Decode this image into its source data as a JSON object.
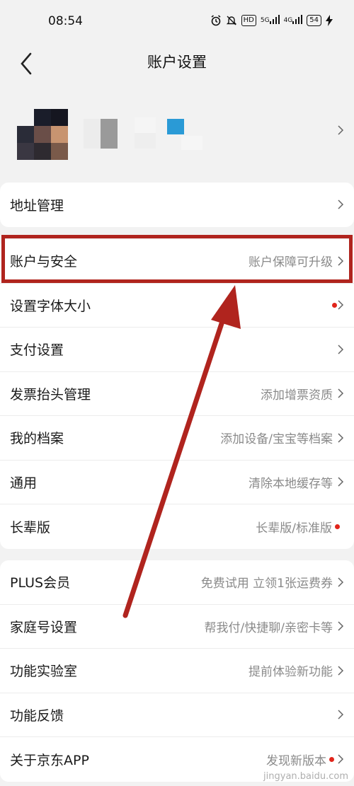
{
  "status_bar": {
    "time": "08:54",
    "indicators": [
      "alarm-icon",
      "mute-icon"
    ],
    "hd_label": "HD",
    "signal1": "5G",
    "signal2": "4G",
    "battery": "54"
  },
  "header": {
    "title": "账户设置"
  },
  "sections": [
    {
      "items": [
        {
          "label": "地址管理",
          "value": "",
          "dot": false
        }
      ]
    },
    {
      "items": [
        {
          "label": "账户与安全",
          "value": "账户保障可升级",
          "dot": false
        },
        {
          "label": "设置字体大小",
          "value": "",
          "dot": true
        },
        {
          "label": "支付设置",
          "value": "",
          "dot": false
        },
        {
          "label": "发票抬头管理",
          "value": "添加增票资质",
          "dot": false
        },
        {
          "label": "我的档案",
          "value": "添加设备/宝宝等档案",
          "dot": false
        },
        {
          "label": "通用",
          "value": "清除本地缓存等",
          "dot": false
        },
        {
          "label": "长辈版",
          "value": "长辈版/标准版",
          "dot": true
        }
      ]
    },
    {
      "items": [
        {
          "label": "PLUS会员",
          "value": "免费试用 立领1张运费券",
          "dot": false
        },
        {
          "label": "家庭号设置",
          "value": "帮我付/快捷聊/亲密卡等",
          "dot": false
        },
        {
          "label": "功能实验室",
          "value": "提前体验新功能",
          "dot": false
        },
        {
          "label": "功能反馈",
          "value": "",
          "dot": false
        },
        {
          "label": "关于京东APP",
          "value": "发现新版本",
          "dot": true
        }
      ]
    }
  ],
  "annotation_color": "#b0241e",
  "watermark": "jingyan.baidu.com"
}
